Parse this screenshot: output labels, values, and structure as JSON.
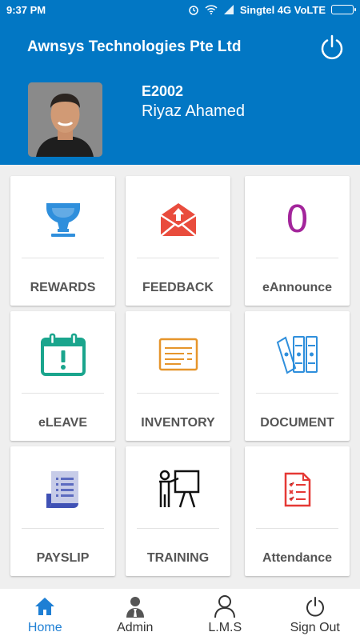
{
  "status_bar": {
    "time": "9:37 PM",
    "carrier": "Singtel 4G VoLTE"
  },
  "header": {
    "company": "Awnsys Technologies Pte Ltd",
    "employee_id": "E2002",
    "employee_name": "Riyaz Ahamed"
  },
  "tiles": [
    {
      "label": "REWARDS",
      "icon": "trophy-icon"
    },
    {
      "label": "FEEDBACK",
      "icon": "envelope-icon"
    },
    {
      "label": "eAnnounce",
      "icon": "announcement-count",
      "count": "0"
    },
    {
      "label": "eLEAVE",
      "icon": "calendar-icon"
    },
    {
      "label": "INVENTORY",
      "icon": "inventory-icon"
    },
    {
      "label": "DOCUMENT",
      "icon": "binders-icon"
    },
    {
      "label": "PAYSLIP",
      "icon": "payslip-icon"
    },
    {
      "label": "TRAINING",
      "icon": "trainer-icon"
    },
    {
      "label": "Attendance",
      "icon": "checklist-icon"
    }
  ],
  "bottom_nav": [
    {
      "label": "Home",
      "icon": "home-icon",
      "active": true
    },
    {
      "label": "Admin",
      "icon": "admin-icon",
      "active": false
    },
    {
      "label": "L.M.S",
      "icon": "person-icon",
      "active": false
    },
    {
      "label": "Sign Out",
      "icon": "power-icon",
      "active": false
    }
  ],
  "colors": {
    "primary": "#0277c4",
    "active_nav": "#1e7fd4",
    "announce_count": "#a3259b"
  }
}
